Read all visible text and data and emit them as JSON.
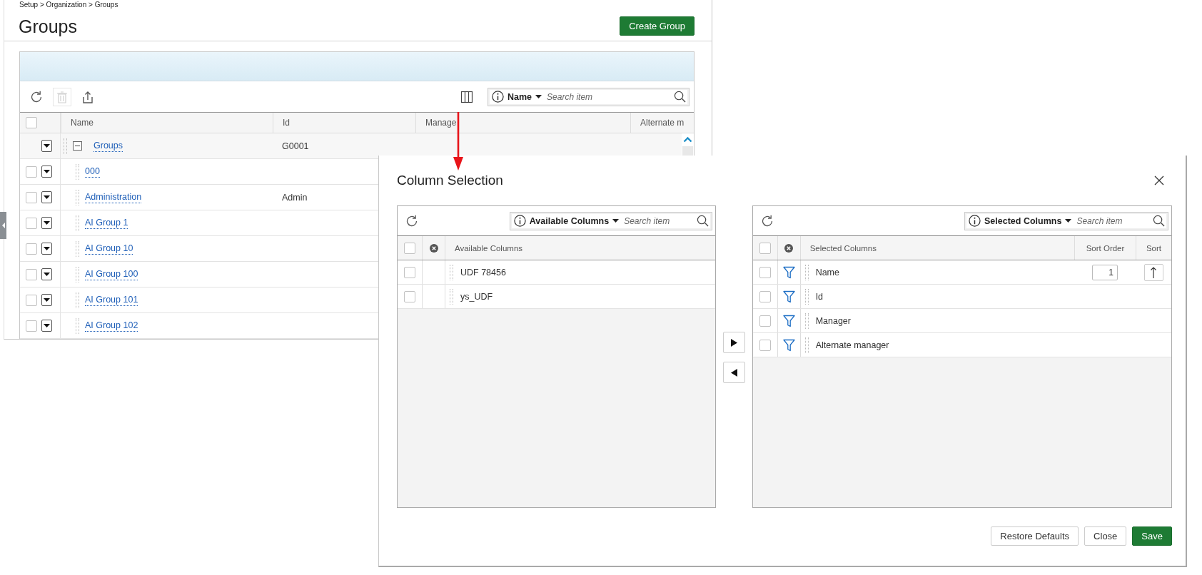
{
  "breadcrumb": "Setup > Organization > Groups",
  "page_title": "Groups",
  "create_button": "Create Group",
  "grid": {
    "toolbar": [
      {
        "kind": "refresh",
        "disabled": false
      },
      {
        "kind": "delete",
        "disabled": true
      },
      {
        "kind": "export",
        "disabled": false
      }
    ],
    "search": {
      "field": "Name",
      "placeholder": "Search item"
    },
    "header_checked": false,
    "columns": [
      "Name",
      "Id",
      "Manage",
      "Alternate m"
    ],
    "rows": [
      {
        "name": "Groups",
        "id": "G0001",
        "expanded": true,
        "children": [
          {
            "name": "000",
            "checked": false
          },
          {
            "name": "Administration",
            "id": "Admin",
            "checked": false
          },
          {
            "name": "AI Group 1",
            "checked": false
          },
          {
            "name": "AI Group 10",
            "checked": false
          },
          {
            "name": "AI Group 100",
            "checked": false
          },
          {
            "name": "AI Group 101",
            "checked": false
          },
          {
            "name": "AI Group 102",
            "checked": false
          }
        ]
      }
    ]
  },
  "dialog": {
    "title": "Column Selection",
    "available": {
      "search": {
        "field": "Available Columns",
        "placeholder": "Search item"
      },
      "header_checked": false,
      "columns": [
        "Available Columns"
      ],
      "rows": [
        {
          "label": "UDF 78456",
          "checked": false
        },
        {
          "label": "ys_UDF",
          "checked": false
        }
      ]
    },
    "selected": {
      "search": {
        "field": "Selected Columns",
        "placeholder": "Search item"
      },
      "header_checked": false,
      "columns": [
        "Selected Columns",
        "Sort Order",
        "Sort"
      ],
      "rows": [
        {
          "label": "Name",
          "checked": false,
          "sort_order": "1",
          "sort_ascending": true
        },
        {
          "label": "Id",
          "checked": false
        },
        {
          "label": "Manager",
          "checked": false
        },
        {
          "label": "Alternate manager",
          "checked": false
        }
      ]
    },
    "buttons": [
      {
        "label": "Restore Defaults",
        "kind": "secondary"
      },
      {
        "label": "Close",
        "kind": "secondary"
      },
      {
        "label": "Save",
        "kind": "primary"
      }
    ]
  }
}
